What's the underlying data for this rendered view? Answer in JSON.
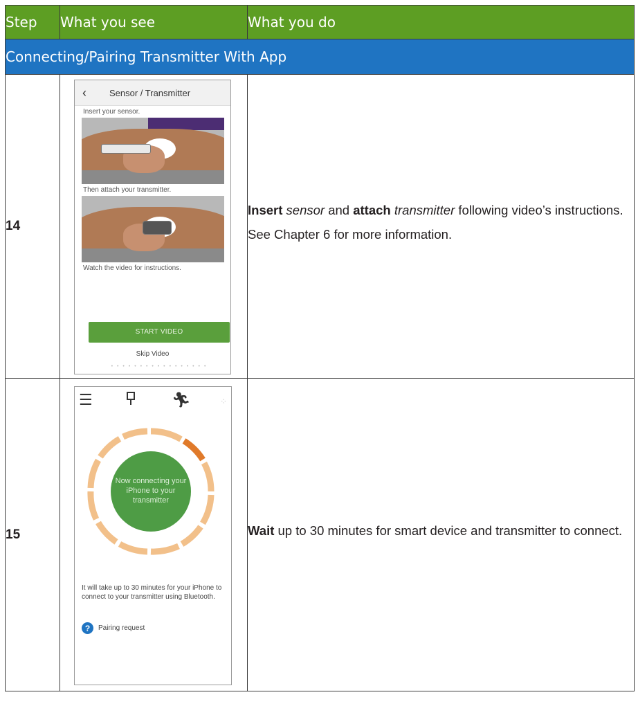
{
  "header": {
    "step": "Step",
    "see": "What you see",
    "do": "What you do"
  },
  "section": "Connecting/Pairing Transmitter With App",
  "rows": [
    {
      "step": "14",
      "phone": {
        "title": "Sensor / Transmitter",
        "cap1": "Insert your sensor.",
        "cap2": "Then attach your transmitter.",
        "cap3": "Watch the video for instructions.",
        "button": "START VIDEO",
        "skip": "Skip Video"
      },
      "do": {
        "b1": "Insert",
        "i1": "sensor",
        "t1": " and ",
        "b2": "attach",
        "i2": "transmitter",
        "t2": " following video’s instructions.",
        "p2": "See Chapter 6 for more information."
      }
    },
    {
      "step": "15",
      "phone": {
        "circle": "Now connecting your iPhone to your transmitter",
        "message": "It will take up to 30 minutes for your iPhone to connect to your transmitter using Bluetooth.",
        "pairing": "Pairing request"
      },
      "do": {
        "b1": "Wait",
        "t1": " up to 30 minutes for smart device and transmitter to connect."
      }
    }
  ],
  "colors": {
    "header": "#5d9e23",
    "section": "#1f74c2",
    "ring": "#f2c08a",
    "ring_active": "#e07a2a",
    "circle": "#4e9c45"
  }
}
